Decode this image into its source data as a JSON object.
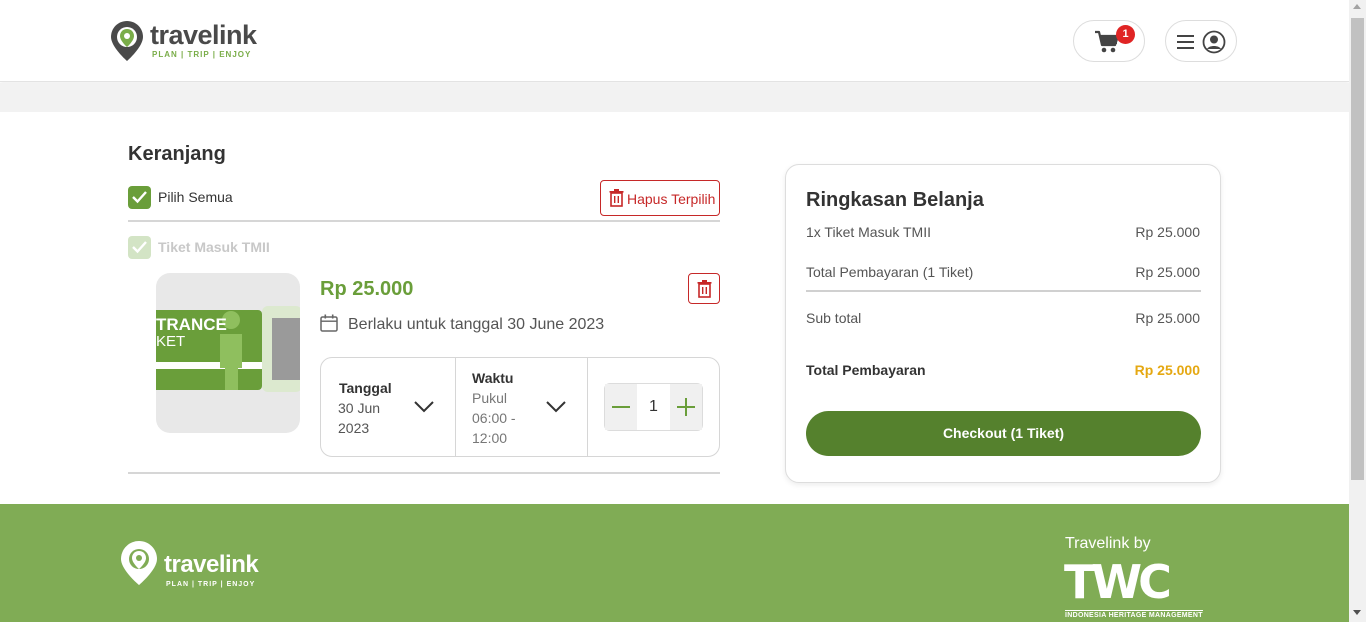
{
  "header": {
    "logo_name": "travelink",
    "logo_tagline": "PLAN | TRIP | ENJOY",
    "cart_badge": "1"
  },
  "cart": {
    "title": "Keranjang",
    "select_all_label": "Pilih Semua",
    "delete_selected_label": "Hapus Terpilih",
    "product_label": "Tiket Masuk TMII",
    "item": {
      "image_text_line1": "TRANCE",
      "image_text_line2": "KET",
      "price": "Rp 25.000",
      "valid_date": "Berlaku untuk tanggal 30 June 2023",
      "date_label": "Tanggal",
      "date_value_line1": "30 Jun",
      "date_value_line2": "2023",
      "time_label": "Waktu",
      "time_value_line1": "Pukul",
      "time_value_line2": "06:00 -",
      "time_value_line3": "12:00",
      "quantity": "1"
    }
  },
  "summary": {
    "title": "Ringkasan Belanja",
    "line_item_label": "1x Tiket Masuk TMII",
    "line_item_value": "Rp 25.000",
    "total_payment_label": "Total Pembayaran (1 Tiket)",
    "total_payment_value": "Rp 25.000",
    "subtotal_label": "Sub total",
    "subtotal_value": "Rp 25.000",
    "grand_total_label": "Total Pembayaran",
    "grand_total_value": "Rp 25.000",
    "checkout_label": "Checkout (1 Tiket)"
  },
  "footer": {
    "logo_name": "travelink",
    "logo_tagline": "PLAN | TRIP | ENJOY",
    "partner_by": "Travelink by",
    "partner_mark": "TWC",
    "partner_sub": "INDONESIA HERITAGE MANAGEMENT"
  },
  "colors": {
    "brand_green": "#6a9e3a",
    "footer_green": "#80ac55",
    "checkout_green": "#55812d",
    "danger_red": "#c62828",
    "total_orange": "#e5a812"
  },
  "icons": [
    "location-pin-icon",
    "cart-icon",
    "hamburger-icon",
    "user-circle-icon",
    "check-icon",
    "trash-icon",
    "calendar-icon",
    "chevron-down-icon",
    "minus-icon",
    "plus-icon"
  ]
}
